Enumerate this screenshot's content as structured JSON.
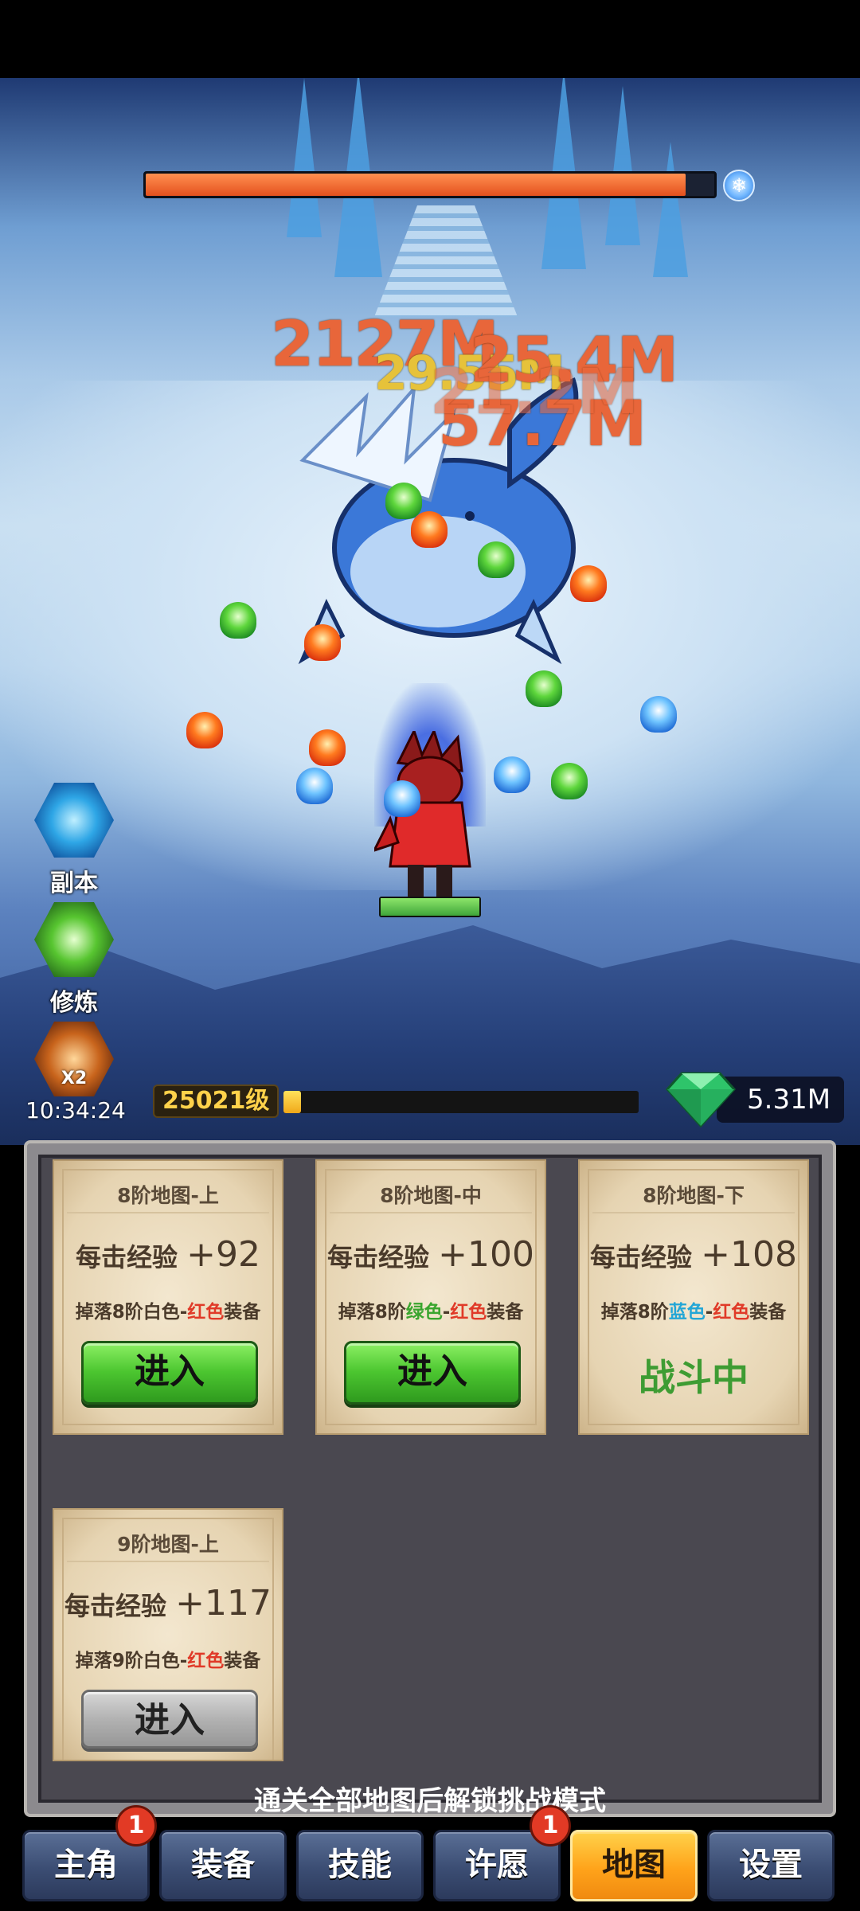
{
  "boss": {
    "hp_fraction": 0.95,
    "element_icon": "snowflake-icon"
  },
  "damage_numbers": [
    "2127M",
    "29.55M",
    "25.4M",
    "57.7M",
    "21.2M"
  ],
  "side_menu": {
    "dungeon_label": "副本",
    "training_label": "修炼",
    "boost_label": "X2",
    "boost_timer": "10:34:24"
  },
  "player": {
    "level_label": "25021级",
    "exp_fraction": 0.05,
    "gems": "5.31M"
  },
  "maps": [
    {
      "title": "8阶地图-上",
      "exp_prefix": "每击经验",
      "exp_value": "+92",
      "drop_prefix": "掉落8阶",
      "drop_color1": "白色",
      "drop_dash": "-",
      "drop_color2": "红色",
      "drop_suffix": "装备",
      "action": "进入"
    },
    {
      "title": "8阶地图-中",
      "exp_prefix": "每击经验",
      "exp_value": "+100",
      "drop_prefix": "掉落8阶",
      "drop_color1": "绿色",
      "drop_dash": "-",
      "drop_color2": "红色",
      "drop_suffix": "装备",
      "action": "进入"
    },
    {
      "title": "8阶地图-下",
      "exp_prefix": "每击经验",
      "exp_value": "+108",
      "drop_prefix": "掉落8阶",
      "drop_color1": "蓝色",
      "drop_dash": "-",
      "drop_color2": "红色",
      "drop_suffix": "装备",
      "action": "战斗中"
    },
    {
      "title": "9阶地图-上",
      "exp_prefix": "每击经验",
      "exp_value": "+117",
      "drop_prefix": "掉落9阶",
      "drop_color1": "白色",
      "drop_dash": "-",
      "drop_color2": "红色",
      "drop_suffix": "装备",
      "action": "进入"
    }
  ],
  "unlock_hint": "通关全部地图后解锁挑战模式",
  "nav": {
    "items": [
      {
        "label": "主角",
        "badge": "1"
      },
      {
        "label": "装备"
      },
      {
        "label": "技能"
      },
      {
        "label": "许愿",
        "badge": "1"
      },
      {
        "label": "地图",
        "active": true
      },
      {
        "label": "设置"
      }
    ]
  }
}
